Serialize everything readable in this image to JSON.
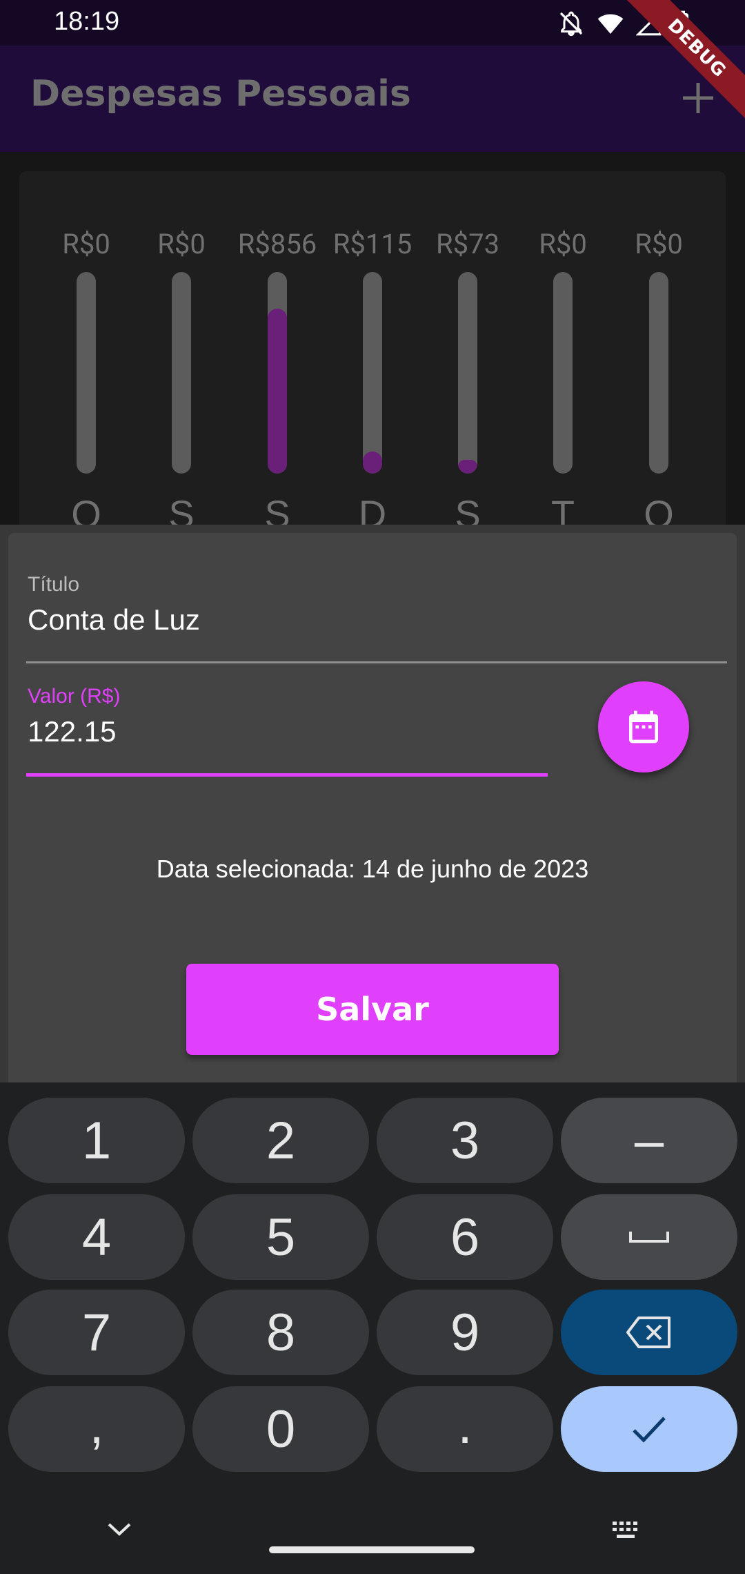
{
  "status_bar": {
    "time": "18:19",
    "icons": [
      "notifications-off-icon",
      "wifi-icon",
      "signal-icon",
      "battery-icon"
    ]
  },
  "debug_banner": "DEBUG",
  "app_bar": {
    "title": "Despesas Pessoais",
    "add_icon": "plus-icon"
  },
  "weekly_chart": {
    "bars": [
      {
        "day": "Q",
        "value_label": "R$0",
        "fill_fraction": 0
      },
      {
        "day": "S",
        "value_label": "R$0",
        "fill_fraction": 0
      },
      {
        "day": "S",
        "value_label": "R$856",
        "fill_fraction": 0.82
      },
      {
        "day": "D",
        "value_label": "R$115",
        "fill_fraction": 0.11
      },
      {
        "day": "S",
        "value_label": "R$73",
        "fill_fraction": 0.07
      },
      {
        "day": "T",
        "value_label": "R$0",
        "fill_fraction": 0
      },
      {
        "day": "Q",
        "value_label": "R$0",
        "fill_fraction": 0
      }
    ],
    "fill_color": "#6a1f78",
    "track_color": "#5c5c5c"
  },
  "form": {
    "title_field": {
      "label": "Título",
      "value": "Conta de Luz"
    },
    "value_field": {
      "label": "Valor (R$)",
      "value": "122.15"
    },
    "date_button_icon": "calendar-icon",
    "selected_date_text": "Data selecionada: 14 de junho de 2023",
    "save_label": "Salvar",
    "accent_color": "#e040fb"
  },
  "keyboard": {
    "rows": [
      [
        "1",
        "2",
        "3",
        "–"
      ],
      [
        "4",
        "5",
        "6",
        "space"
      ],
      [
        "7",
        "8",
        "9",
        "backspace"
      ],
      [
        ",",
        "0",
        ".",
        "done"
      ]
    ],
    "nav_icons": [
      "chevron-down-icon",
      "keyboard-icon"
    ]
  }
}
